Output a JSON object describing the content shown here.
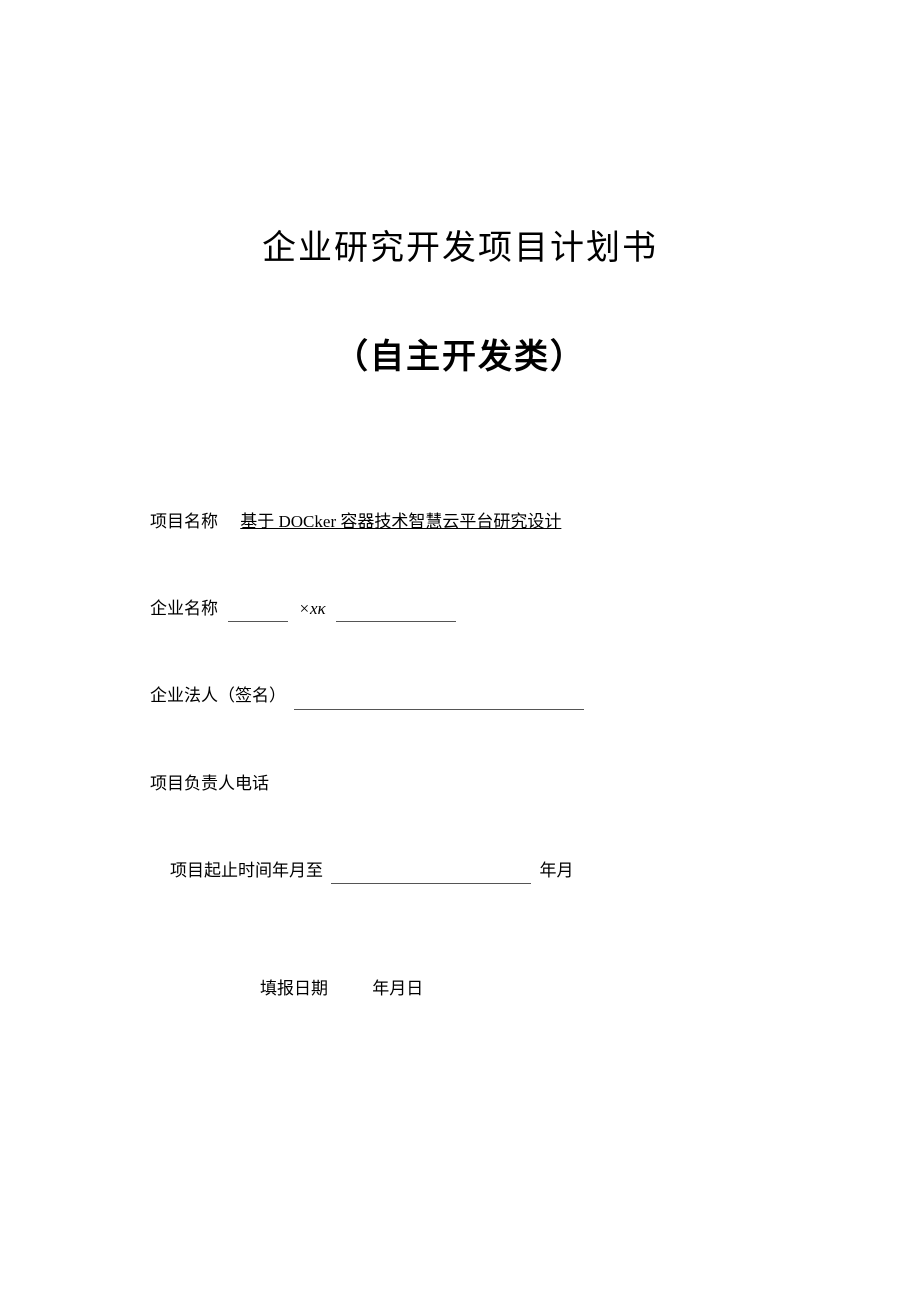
{
  "title_main": "企业研究开发项目计划书",
  "title_sub": "（自主开发类）",
  "fields": {
    "project_name_label": "项目名称",
    "project_name_value": "基于 DOCker 容器技术智慧云平台研究设计",
    "company_name_label": "企业名称",
    "company_name_value": "×xκ",
    "legal_person_label": "企业法人（签名）",
    "contact_label": "项目负责人电话",
    "duration_prefix": "项目起止时间年月至",
    "duration_suffix": "年月"
  },
  "footer": {
    "report_label": "填报日期",
    "date_format": "年月日"
  }
}
